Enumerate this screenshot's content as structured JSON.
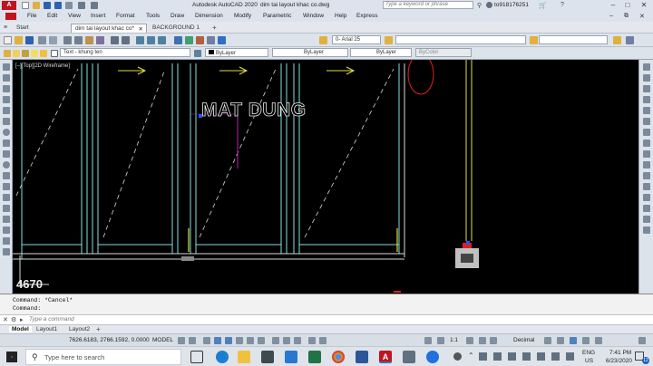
{
  "window": {
    "title": "Autodesk AutoCAD 2020",
    "filename": "dim tai layout khac co.dwg",
    "search_placeholder": "Type a keyword or phrase",
    "user": "to918176251"
  },
  "menu": [
    "File",
    "Edit",
    "View",
    "Insert",
    "Format",
    "Tools",
    "Draw",
    "Dimension",
    "Modify",
    "Parametric",
    "Window",
    "Help",
    "Express"
  ],
  "doc_tabs": [
    {
      "label": "Start",
      "active": false
    },
    {
      "label": "dim tai layout khac co*",
      "active": true
    },
    {
      "label": "BACKGROUND 1",
      "active": false
    }
  ],
  "toolbar1": {
    "textstyle": "0- Arial 25"
  },
  "toolbar2": {
    "text_label": "Text - khung ten",
    "layer_color": "ByLayer",
    "linetype": "ByLayer",
    "lineweight": "ByLayer",
    "plotstyle": "ByColor"
  },
  "viewport": {
    "label": "[–][Top][2D Wireframe]",
    "drawing_text": "MAT DUNG",
    "dimension_text": "4670"
  },
  "command": {
    "history": [
      "Command: *Cancel*",
      "Command:"
    ],
    "prompt_placeholder": "Type a command"
  },
  "layout_tabs": [
    "Model",
    "Layout1",
    "Layout2"
  ],
  "status": {
    "coords": "7626.6183, 2766.1592, 0.0000",
    "mode": "MODEL",
    "scale": "1:1",
    "units": "Decimal"
  },
  "taskbar": {
    "search_placeholder": "Type here to search",
    "lang": "ENG",
    "region": "US",
    "time": "7:41 PM",
    "date": "6/23/2020",
    "notification_count": "12"
  },
  "colors": {
    "accent": "#e0e040",
    "wall": "#7fe0e0",
    "text": "#d8d8d8",
    "magenta": "#c020c0",
    "red": "#e02020"
  }
}
